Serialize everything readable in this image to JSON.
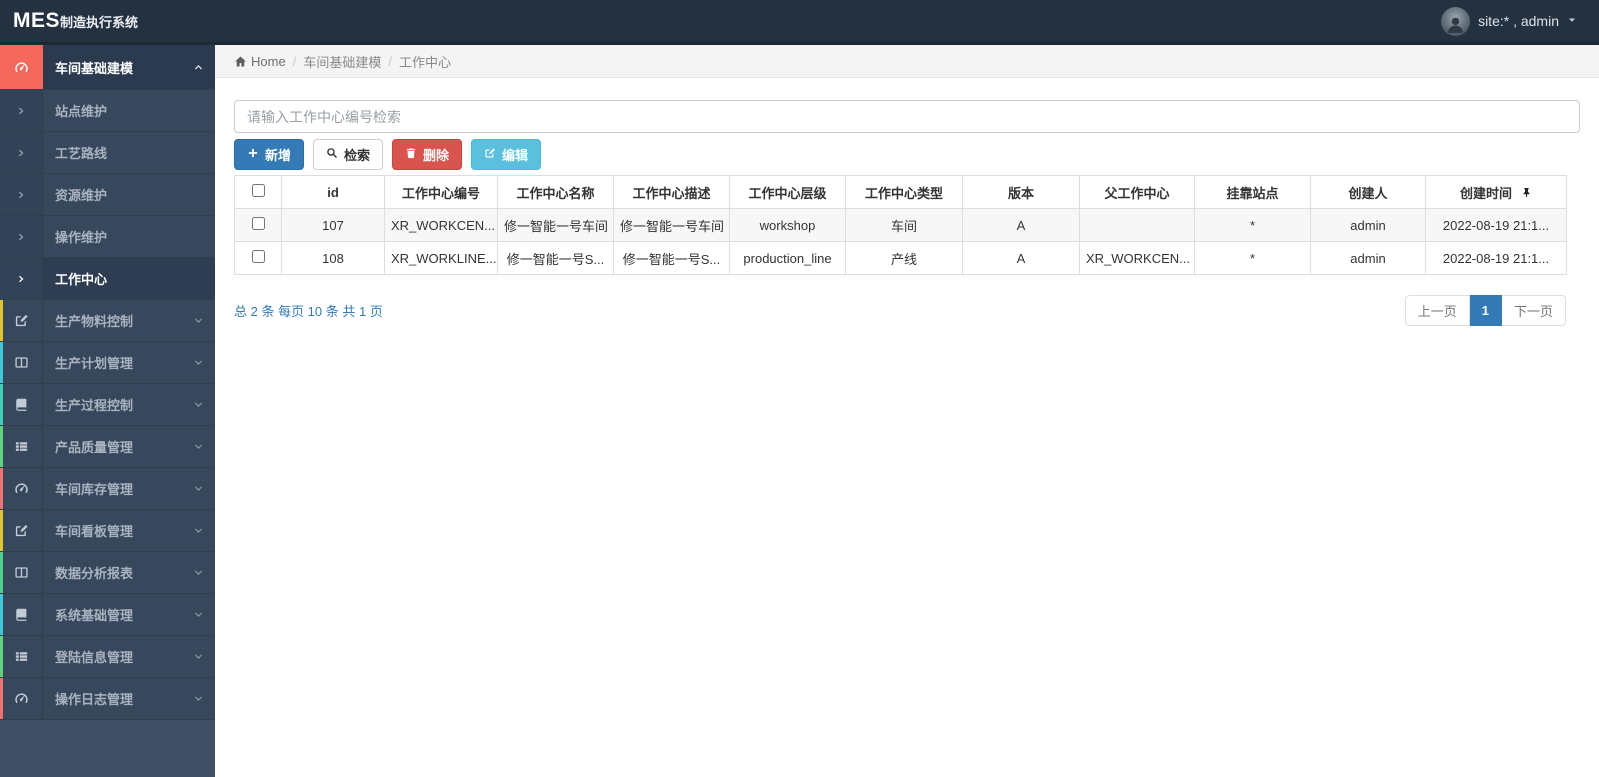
{
  "topbar": {
    "brand": "MES",
    "brand_suffix": "制造执行系统",
    "user_label": "site:* , admin"
  },
  "sidebar": {
    "primary": {
      "label": "车间基础建模",
      "icon": "gauge",
      "icon_bg": "#f4695c",
      "children": [
        {
          "label": "站点维护",
          "active": false
        },
        {
          "label": "工艺路线",
          "active": false
        },
        {
          "label": "资源维护",
          "active": false
        },
        {
          "label": "操作维护",
          "active": false
        },
        {
          "label": "工作中心",
          "active": true
        }
      ]
    },
    "menus": [
      {
        "label": "生产物料控制",
        "icon": "edit",
        "strip": "#dfc52a"
      },
      {
        "label": "生产计划管理",
        "icon": "columns",
        "strip": "#3fc8d4"
      },
      {
        "label": "生产过程控制",
        "icon": "book",
        "strip": "#3fd0b5"
      },
      {
        "label": "产品质量管理",
        "icon": "list",
        "strip": "#5fd27e"
      },
      {
        "label": "车间库存管理",
        "icon": "gauge",
        "strip": "#f2736d"
      },
      {
        "label": "车间看板管理",
        "icon": "edit",
        "strip": "#dfc52a"
      },
      {
        "label": "数据分析报表",
        "icon": "columns",
        "strip": "#4fd08e"
      },
      {
        "label": "系统基础管理",
        "icon": "book",
        "strip": "#3fc8d4"
      },
      {
        "label": "登陆信息管理",
        "icon": "list",
        "strip": "#5fd27e"
      },
      {
        "label": "操作日志管理",
        "icon": "gauge",
        "strip": "#f2736d"
      }
    ]
  },
  "breadcrumb": {
    "home_label": "Home",
    "trail": [
      "车间基础建模",
      "工作中心"
    ]
  },
  "toolbar": {
    "search_placeholder": "请输入工作中心编号检索",
    "add_label": "新增",
    "search_label": "检索",
    "delete_label": "删除",
    "edit_label": "编辑"
  },
  "table": {
    "columns": [
      "id",
      "工作中心编号",
      "工作中心名称",
      "工作中心描述",
      "工作中心层级",
      "工作中心类型",
      "版本",
      "父工作中心",
      "挂靠站点",
      "创建人",
      "创建时间"
    ],
    "rows": [
      [
        "107",
        "XR_WORKCEN...",
        "修一智能一号车间",
        "修一智能一号车间",
        "workshop",
        "车间",
        "A",
        "",
        "*",
        "admin",
        "2022-08-19 21:1..."
      ],
      [
        "108",
        "XR_WORKLINE...",
        "修一智能一号S...",
        "修一智能一号S...",
        "production_line",
        "产线",
        "A",
        "XR_WORKCEN...",
        "*",
        "admin",
        "2022-08-19 21:1..."
      ]
    ]
  },
  "pagination": {
    "summary": "总 2 条 每页 10 条 共 1 页",
    "prev_label": "上一页",
    "current_page": "1",
    "next_label": "下一页"
  },
  "colors": {
    "navbar_bg": "#243140",
    "sidebar_bg": "#37475c",
    "primary_accent": "#337ab7",
    "danger": "#d9534f",
    "info": "#5bc0de",
    "active_menu_icon_bg": "#f4695c"
  }
}
